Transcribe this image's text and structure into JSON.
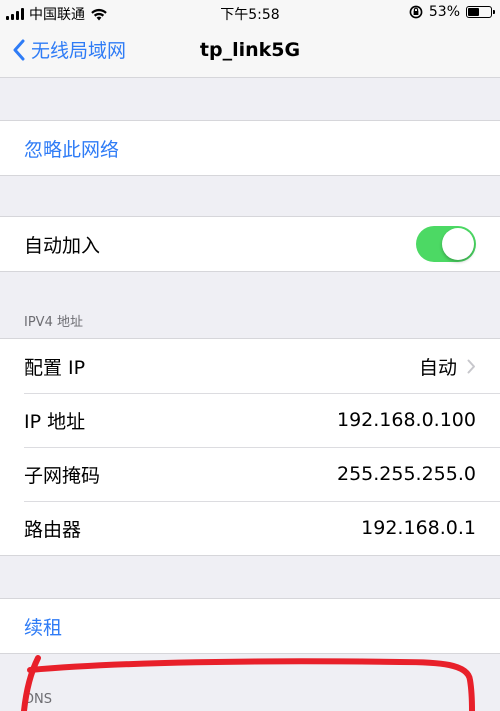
{
  "status_bar": {
    "carrier": "中国联通",
    "time": "下午5:58",
    "battery_percent": "53%",
    "battery_level": 0.53
  },
  "nav": {
    "back_label": "无线局域网",
    "title": "tp_link5G"
  },
  "forget": {
    "label": "忽略此网络"
  },
  "auto_join": {
    "label": "自动加入",
    "enabled": true
  },
  "ipv4": {
    "header": "IPV4 地址",
    "rows": [
      {
        "label": "配置 IP",
        "value": "自动"
      },
      {
        "label": "IP 地址",
        "value": "192.168.0.100"
      },
      {
        "label": "子网掩码",
        "value": "255.255.255.0"
      },
      {
        "label": "路由器",
        "value": "192.168.0.1"
      }
    ]
  },
  "renew": {
    "label": "续租"
  },
  "dns": {
    "header": "DNS"
  },
  "colors": {
    "accent": "#2f7cf6",
    "toggle_on": "#4cd964",
    "background": "#efeff4",
    "annotation": "#e8202a"
  }
}
